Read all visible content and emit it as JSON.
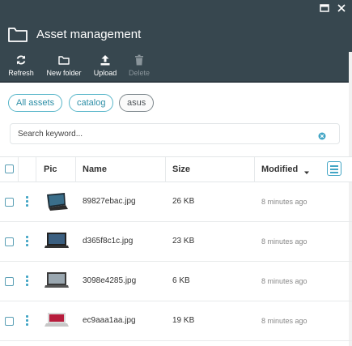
{
  "window": {
    "title": "Asset management"
  },
  "toolbar": {
    "refresh_label": "Refresh",
    "new_folder_label": "New folder",
    "upload_label": "Upload",
    "delete_label": "Delete"
  },
  "tags": [
    "All assets",
    "catalog",
    "asus"
  ],
  "search": {
    "placeholder": "Search keyword..."
  },
  "table": {
    "columns": {
      "pic": "Pic",
      "name": "Name",
      "size": "Size",
      "modified": "Modified"
    },
    "rows": [
      {
        "name": "89827ebac.jpg",
        "size": "26 KB",
        "modified": "8 minutes ago"
      },
      {
        "name": "d365f8c1c.jpg",
        "size": "23 KB",
        "modified": "8 minutes ago"
      },
      {
        "name": "3098e4285.jpg",
        "size": "6 KB",
        "modified": "8 minutes ago"
      },
      {
        "name": "ec9aaa1aa.jpg",
        "size": "19 KB",
        "modified": "8 minutes ago"
      }
    ]
  },
  "colors": {
    "header_bg": "#37474f",
    "accent": "#42a5c5"
  },
  "icons": [
    "folder-icon",
    "refresh-icon",
    "new-folder-icon",
    "upload-icon",
    "trash-icon",
    "clear-search-icon",
    "column-menu-icon",
    "maximize-icon",
    "close-icon",
    "sort-desc-icon",
    "row-actions-icon"
  ]
}
